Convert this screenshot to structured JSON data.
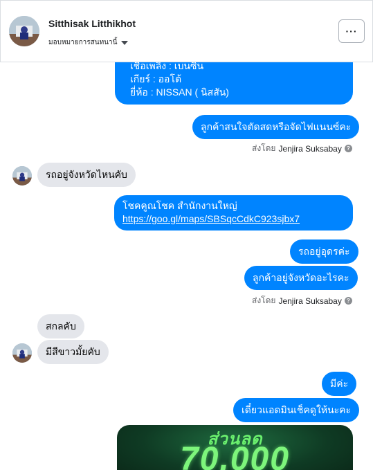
{
  "header": {
    "name": "Sitthisak Litthikhot",
    "subtitle": "มอบหมายการสนทนานี้",
    "more_label": "···"
  },
  "messages": {
    "m1_line1": "เชื้อเพลิง : เบนซิน",
    "m1_line2": "เกียร์ : ออโต้",
    "m1_line3": "ยี่ห้อ : NISSAN ( นิสสัน)",
    "m2": "ลูกค้าสนใจตัดสดหรือจัดไฟแนนซ์คะ",
    "seen1_prefix": "ส่งโดย",
    "seen1_name": "Jenjira Suksabay",
    "m3": "รถอยู่จังหวัดไหนคับ",
    "m4_line1": "โชคคูณโชค สำนักงานใหญ่",
    "m4_link": "https://goo.gl/maps/SBSqcCdkC923sjbx7",
    "m5": "รถอยู่อุดรค่ะ",
    "m6": "ลูกค้าอยู่จังหวัดอะไรคะ",
    "seen2_prefix": "ส่งโดย",
    "seen2_name": "Jenjira Suksabay",
    "m7": "สกลคับ",
    "m8": "มีสีขาวมั้ยคับ",
    "m9": "มีค่ะ",
    "m10": "เดี๋ยวแอดมินเช็คดูให้นะคะ",
    "promo_line1": "ส่วนลด",
    "promo_line2": "70,000"
  },
  "colors": {
    "outgoing_bubble": "#0084ff",
    "incoming_bubble": "#e4e6eb",
    "promo_text": "#7df57b"
  }
}
